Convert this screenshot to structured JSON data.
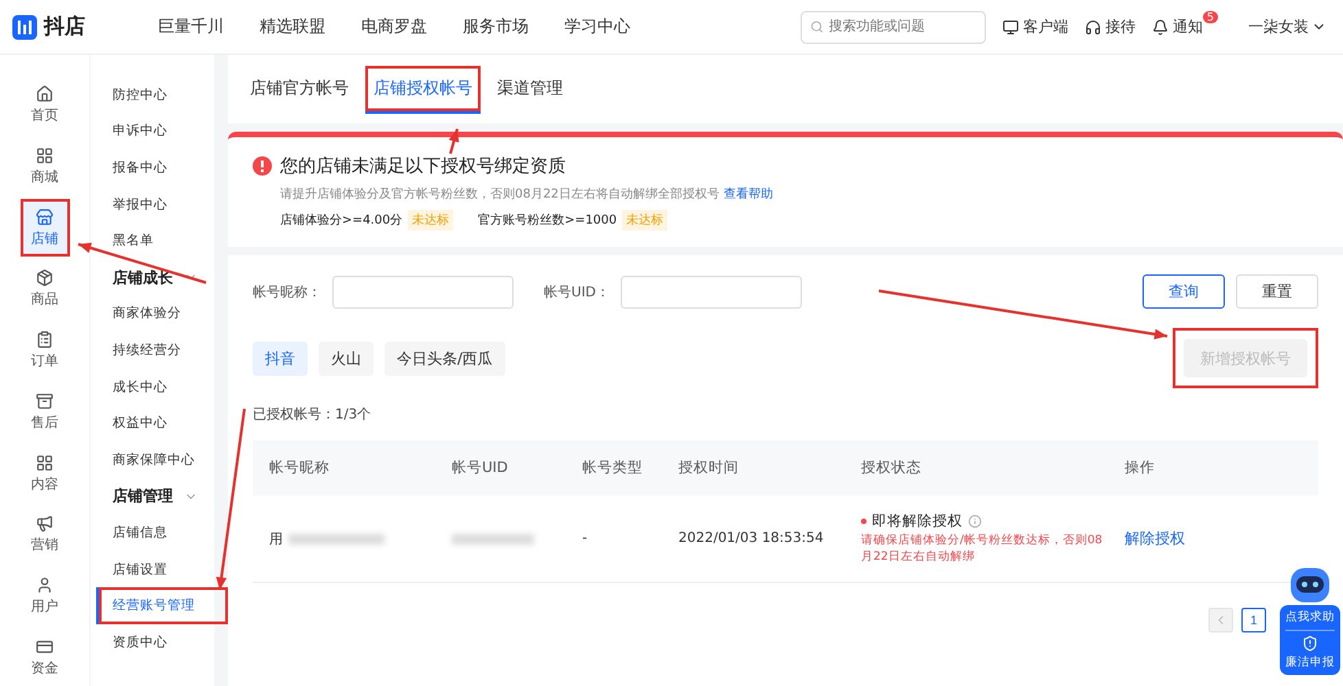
{
  "topbar": {
    "logo": "抖店",
    "nav": [
      "巨量千川",
      "精选联盟",
      "电商罗盘",
      "服务市场",
      "学习中心"
    ],
    "search": {
      "placeholder": "搜索功能或问题"
    },
    "actions": [
      {
        "kind": "client",
        "label": "客户端"
      },
      {
        "kind": "service",
        "label": "接待"
      },
      {
        "kind": "bell",
        "label": "通知",
        "badge": "5"
      }
    ],
    "user": "一柒女装"
  },
  "rail": [
    {
      "kind": "home",
      "label": "首页",
      "selected": false,
      "highlighted": false
    },
    {
      "kind": "mall",
      "label": "商城",
      "selected": false,
      "highlighted": false
    },
    {
      "kind": "store",
      "label": "店铺",
      "selected": true,
      "highlighted": true
    },
    {
      "kind": "goods",
      "label": "商品",
      "selected": false,
      "highlighted": false
    },
    {
      "kind": "order",
      "label": "订单",
      "selected": false,
      "highlighted": false
    },
    {
      "kind": "after",
      "label": "售后",
      "selected": false,
      "highlighted": false
    },
    {
      "kind": "content",
      "label": "内容",
      "selected": false,
      "highlighted": false
    },
    {
      "kind": "market",
      "label": "营销",
      "selected": false,
      "highlighted": false
    },
    {
      "kind": "user",
      "label": "用户",
      "selected": false,
      "highlighted": false
    },
    {
      "kind": "fund",
      "label": "资金",
      "selected": false,
      "highlighted": false
    }
  ],
  "submenu": [
    {
      "kind": "item",
      "label": "防控中心",
      "selected": false,
      "highlighted": false
    },
    {
      "kind": "item",
      "label": "申诉中心",
      "selected": false,
      "highlighted": false
    },
    {
      "kind": "item",
      "label": "报备中心",
      "selected": false,
      "highlighted": false
    },
    {
      "kind": "item",
      "label": "举报中心",
      "selected": false,
      "highlighted": false
    },
    {
      "kind": "item",
      "label": "黑名单",
      "selected": false,
      "highlighted": false
    },
    {
      "kind": "group",
      "label": "店铺成长"
    },
    {
      "kind": "item",
      "label": "商家体验分",
      "selected": false,
      "highlighted": false
    },
    {
      "kind": "item",
      "label": "持续经营分",
      "selected": false,
      "highlighted": false
    },
    {
      "kind": "item",
      "label": "成长中心",
      "selected": false,
      "highlighted": false
    },
    {
      "kind": "item",
      "label": "权益中心",
      "selected": false,
      "highlighted": false
    },
    {
      "kind": "item",
      "label": "商家保障中心",
      "selected": false,
      "highlighted": false
    },
    {
      "kind": "group",
      "label": "店铺管理"
    },
    {
      "kind": "item",
      "label": "店铺信息",
      "selected": false,
      "highlighted": false
    },
    {
      "kind": "item",
      "label": "店铺设置",
      "selected": false,
      "highlighted": false
    },
    {
      "kind": "item",
      "label": "经营账号管理",
      "selected": true,
      "highlighted": true
    },
    {
      "kind": "item",
      "label": "资质中心",
      "selected": false,
      "highlighted": false
    }
  ],
  "tabs": [
    {
      "label": "店铺官方帐号",
      "selected": false,
      "highlighted": false
    },
    {
      "label": "店铺授权帐号",
      "selected": true,
      "highlighted": true
    },
    {
      "label": "渠道管理",
      "selected": false,
      "highlighted": false
    }
  ],
  "alert": {
    "title": "您的店铺未满足以下授权号绑定资质",
    "text": "请提升店铺体验分及官方帐号粉丝数，否则08月22日左右将自动解绑全部授权号",
    "link": "查看帮助",
    "conditions": [
      {
        "label": "店铺体验分>=4.00分",
        "status": "未达标"
      },
      {
        "label": "官方账号粉丝数>=1000",
        "status": "未达标"
      }
    ]
  },
  "filters": [
    {
      "label": "帐号昵称："
    },
    {
      "label": "帐号UID："
    }
  ],
  "buttons": [
    {
      "kind": "primary",
      "label": "查询"
    },
    {
      "kind": "default",
      "label": "重置"
    }
  ],
  "platforms": [
    {
      "label": "抖音",
      "selected": true
    },
    {
      "label": "火山",
      "selected": false
    },
    {
      "label": "今日头条/西瓜",
      "selected": false
    }
  ],
  "add_button": {
    "label": "新增授权帐号",
    "disabled": true,
    "highlighted": true
  },
  "count": "已授权帐号：1/3个",
  "table": {
    "columns": [
      "帐号昵称",
      "帐号UID",
      "帐号类型",
      "授权时间",
      "授权状态",
      "操作"
    ],
    "rows": [
      {
        "nickname": "用",
        "type": "-",
        "time": "2022/01/03 18:53:54",
        "status": "即将解除授权",
        "status_note": "请确保店铺体验分/帐号粉丝数达标，否则08月22日左右自动解绑",
        "action": "解除授权"
      }
    ]
  },
  "pagination": {
    "page": "1"
  },
  "helper": {
    "primary": "点我求助",
    "secondary": "廉洁申报"
  }
}
